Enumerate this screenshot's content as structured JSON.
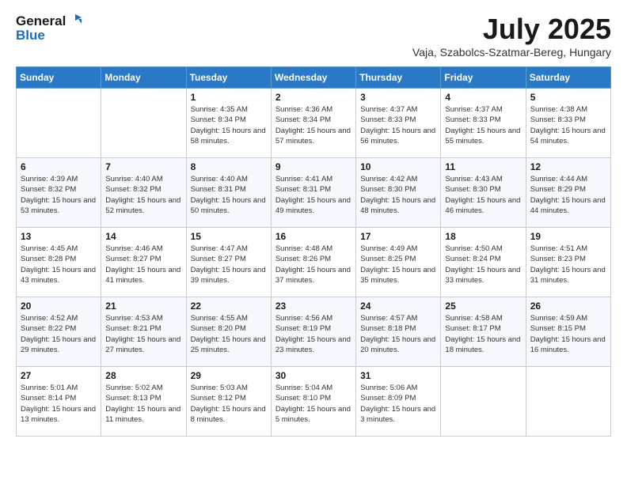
{
  "header": {
    "logo_line1": "General",
    "logo_line2": "Blue",
    "month": "July 2025",
    "location": "Vaja, Szabolcs-Szatmar-Bereg, Hungary"
  },
  "weekdays": [
    "Sunday",
    "Monday",
    "Tuesday",
    "Wednesday",
    "Thursday",
    "Friday",
    "Saturday"
  ],
  "weeks": [
    [
      {
        "day": "",
        "sunrise": "",
        "sunset": "",
        "daylight": "",
        "empty": true
      },
      {
        "day": "",
        "sunrise": "",
        "sunset": "",
        "daylight": "",
        "empty": true
      },
      {
        "day": "1",
        "sunrise": "Sunrise: 4:35 AM",
        "sunset": "Sunset: 8:34 PM",
        "daylight": "Daylight: 15 hours and 58 minutes.",
        "empty": false
      },
      {
        "day": "2",
        "sunrise": "Sunrise: 4:36 AM",
        "sunset": "Sunset: 8:34 PM",
        "daylight": "Daylight: 15 hours and 57 minutes.",
        "empty": false
      },
      {
        "day": "3",
        "sunrise": "Sunrise: 4:37 AM",
        "sunset": "Sunset: 8:33 PM",
        "daylight": "Daylight: 15 hours and 56 minutes.",
        "empty": false
      },
      {
        "day": "4",
        "sunrise": "Sunrise: 4:37 AM",
        "sunset": "Sunset: 8:33 PM",
        "daylight": "Daylight: 15 hours and 55 minutes.",
        "empty": false
      },
      {
        "day": "5",
        "sunrise": "Sunrise: 4:38 AM",
        "sunset": "Sunset: 8:33 PM",
        "daylight": "Daylight: 15 hours and 54 minutes.",
        "empty": false
      }
    ],
    [
      {
        "day": "6",
        "sunrise": "Sunrise: 4:39 AM",
        "sunset": "Sunset: 8:32 PM",
        "daylight": "Daylight: 15 hours and 53 minutes.",
        "empty": false
      },
      {
        "day": "7",
        "sunrise": "Sunrise: 4:40 AM",
        "sunset": "Sunset: 8:32 PM",
        "daylight": "Daylight: 15 hours and 52 minutes.",
        "empty": false
      },
      {
        "day": "8",
        "sunrise": "Sunrise: 4:40 AM",
        "sunset": "Sunset: 8:31 PM",
        "daylight": "Daylight: 15 hours and 50 minutes.",
        "empty": false
      },
      {
        "day": "9",
        "sunrise": "Sunrise: 4:41 AM",
        "sunset": "Sunset: 8:31 PM",
        "daylight": "Daylight: 15 hours and 49 minutes.",
        "empty": false
      },
      {
        "day": "10",
        "sunrise": "Sunrise: 4:42 AM",
        "sunset": "Sunset: 8:30 PM",
        "daylight": "Daylight: 15 hours and 48 minutes.",
        "empty": false
      },
      {
        "day": "11",
        "sunrise": "Sunrise: 4:43 AM",
        "sunset": "Sunset: 8:30 PM",
        "daylight": "Daylight: 15 hours and 46 minutes.",
        "empty": false
      },
      {
        "day": "12",
        "sunrise": "Sunrise: 4:44 AM",
        "sunset": "Sunset: 8:29 PM",
        "daylight": "Daylight: 15 hours and 44 minutes.",
        "empty": false
      }
    ],
    [
      {
        "day": "13",
        "sunrise": "Sunrise: 4:45 AM",
        "sunset": "Sunset: 8:28 PM",
        "daylight": "Daylight: 15 hours and 43 minutes.",
        "empty": false
      },
      {
        "day": "14",
        "sunrise": "Sunrise: 4:46 AM",
        "sunset": "Sunset: 8:27 PM",
        "daylight": "Daylight: 15 hours and 41 minutes.",
        "empty": false
      },
      {
        "day": "15",
        "sunrise": "Sunrise: 4:47 AM",
        "sunset": "Sunset: 8:27 PM",
        "daylight": "Daylight: 15 hours and 39 minutes.",
        "empty": false
      },
      {
        "day": "16",
        "sunrise": "Sunrise: 4:48 AM",
        "sunset": "Sunset: 8:26 PM",
        "daylight": "Daylight: 15 hours and 37 minutes.",
        "empty": false
      },
      {
        "day": "17",
        "sunrise": "Sunrise: 4:49 AM",
        "sunset": "Sunset: 8:25 PM",
        "daylight": "Daylight: 15 hours and 35 minutes.",
        "empty": false
      },
      {
        "day": "18",
        "sunrise": "Sunrise: 4:50 AM",
        "sunset": "Sunset: 8:24 PM",
        "daylight": "Daylight: 15 hours and 33 minutes.",
        "empty": false
      },
      {
        "day": "19",
        "sunrise": "Sunrise: 4:51 AM",
        "sunset": "Sunset: 8:23 PM",
        "daylight": "Daylight: 15 hours and 31 minutes.",
        "empty": false
      }
    ],
    [
      {
        "day": "20",
        "sunrise": "Sunrise: 4:52 AM",
        "sunset": "Sunset: 8:22 PM",
        "daylight": "Daylight: 15 hours and 29 minutes.",
        "empty": false
      },
      {
        "day": "21",
        "sunrise": "Sunrise: 4:53 AM",
        "sunset": "Sunset: 8:21 PM",
        "daylight": "Daylight: 15 hours and 27 minutes.",
        "empty": false
      },
      {
        "day": "22",
        "sunrise": "Sunrise: 4:55 AM",
        "sunset": "Sunset: 8:20 PM",
        "daylight": "Daylight: 15 hours and 25 minutes.",
        "empty": false
      },
      {
        "day": "23",
        "sunrise": "Sunrise: 4:56 AM",
        "sunset": "Sunset: 8:19 PM",
        "daylight": "Daylight: 15 hours and 23 minutes.",
        "empty": false
      },
      {
        "day": "24",
        "sunrise": "Sunrise: 4:57 AM",
        "sunset": "Sunset: 8:18 PM",
        "daylight": "Daylight: 15 hours and 20 minutes.",
        "empty": false
      },
      {
        "day": "25",
        "sunrise": "Sunrise: 4:58 AM",
        "sunset": "Sunset: 8:17 PM",
        "daylight": "Daylight: 15 hours and 18 minutes.",
        "empty": false
      },
      {
        "day": "26",
        "sunrise": "Sunrise: 4:59 AM",
        "sunset": "Sunset: 8:15 PM",
        "daylight": "Daylight: 15 hours and 16 minutes.",
        "empty": false
      }
    ],
    [
      {
        "day": "27",
        "sunrise": "Sunrise: 5:01 AM",
        "sunset": "Sunset: 8:14 PM",
        "daylight": "Daylight: 15 hours and 13 minutes.",
        "empty": false
      },
      {
        "day": "28",
        "sunrise": "Sunrise: 5:02 AM",
        "sunset": "Sunset: 8:13 PM",
        "daylight": "Daylight: 15 hours and 11 minutes.",
        "empty": false
      },
      {
        "day": "29",
        "sunrise": "Sunrise: 5:03 AM",
        "sunset": "Sunset: 8:12 PM",
        "daylight": "Daylight: 15 hours and 8 minutes.",
        "empty": false
      },
      {
        "day": "30",
        "sunrise": "Sunrise: 5:04 AM",
        "sunset": "Sunset: 8:10 PM",
        "daylight": "Daylight: 15 hours and 5 minutes.",
        "empty": false
      },
      {
        "day": "31",
        "sunrise": "Sunrise: 5:06 AM",
        "sunset": "Sunset: 8:09 PM",
        "daylight": "Daylight: 15 hours and 3 minutes.",
        "empty": false
      },
      {
        "day": "",
        "sunrise": "",
        "sunset": "",
        "daylight": "",
        "empty": true
      },
      {
        "day": "",
        "sunrise": "",
        "sunset": "",
        "daylight": "",
        "empty": true
      }
    ]
  ]
}
